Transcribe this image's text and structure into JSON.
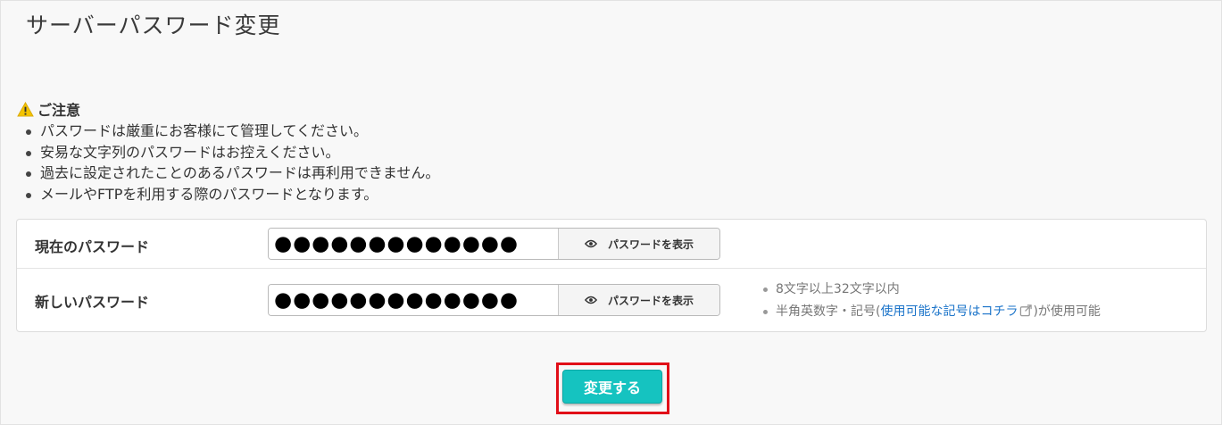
{
  "page": {
    "title": "サーバーパスワード変更"
  },
  "notice": {
    "title": "ご注意",
    "icon": "warning-icon",
    "items": [
      "パスワードは厳重にお客様にて管理してください。",
      "安易な文字列のパスワードはお控えください。",
      "過去に設定されたことのあるパスワードは再利用できません。",
      "メールやFTPを利用する際のパスワードとなります。"
    ]
  },
  "form": {
    "current": {
      "label": "現在のパスワード",
      "value": "●●●●●●●●●●●●●",
      "toggle_label": "パスワードを表示"
    },
    "new": {
      "label": "新しいパスワード",
      "value": "●●●●●●●●●●●●●",
      "toggle_label": "パスワードを表示"
    },
    "hints": {
      "length": "8文字以上32文字以内",
      "charset_prefix": "半角英数字・記号(",
      "charset_link": "使用可能な記号はコチラ",
      "charset_suffix": ")が使用可能"
    }
  },
  "submit": {
    "label": "変更する"
  },
  "colors": {
    "accent": "#15c3c0",
    "highlight_border": "#e10e18",
    "link": "#1a73c9",
    "warning": "#f4c400"
  }
}
